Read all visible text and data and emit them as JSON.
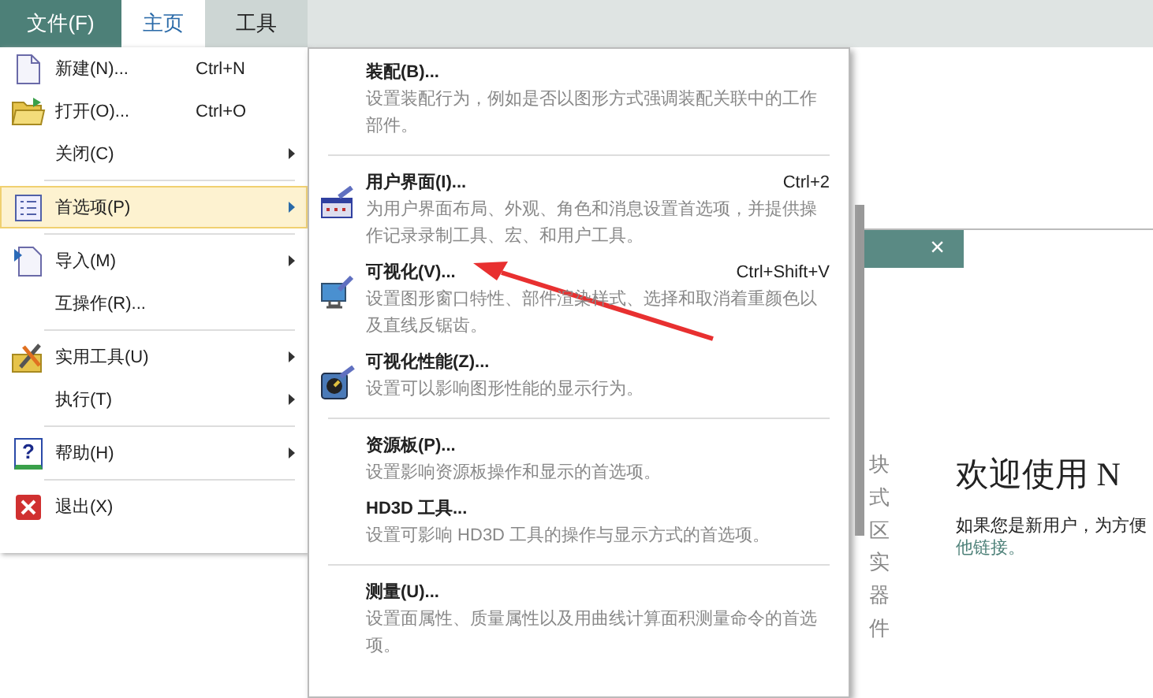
{
  "menu_bar": {
    "tabs": [
      {
        "label": "文件(F)",
        "kind": "file",
        "selected": false
      },
      {
        "label": "主页",
        "kind": "tab",
        "selected": true
      },
      {
        "label": "工具",
        "kind": "tab",
        "selected": false
      }
    ]
  },
  "file_menu": {
    "groups": [
      [
        {
          "label": "新建(N)...",
          "shortcut": "Ctrl+N",
          "submenu": false,
          "selected": false
        },
        {
          "label": "打开(O)...",
          "shortcut": "Ctrl+O",
          "submenu": false,
          "selected": false
        },
        {
          "label": "关闭(C)",
          "submenu": true,
          "selected": false
        }
      ],
      [
        {
          "label": "首选项(P)",
          "submenu": true,
          "selected": true
        }
      ],
      [
        {
          "label": "导入(M)",
          "submenu": true,
          "selected": false
        },
        {
          "label": "互操作(R)...",
          "submenu": false,
          "selected": false
        }
      ],
      [
        {
          "label": "实用工具(U)",
          "submenu": true,
          "selected": false
        },
        {
          "label": "执行(T)",
          "submenu": true,
          "selected": false
        }
      ],
      [
        {
          "label": "帮助(H)",
          "icon_glyph": "?",
          "submenu": true,
          "selected": false
        }
      ],
      [
        {
          "label": "退出(X)",
          "submenu": false,
          "selected": false
        }
      ]
    ]
  },
  "preferences_submenu": {
    "groups": [
      [
        {
          "title": "装配(B)...",
          "description": "设置装配行为，例如是否以图形方式强调装配关联中的工作部件。"
        }
      ],
      [
        {
          "title": "用户界面(I)...",
          "shortcut": "Ctrl+2",
          "description": "为用户界面布局、外观、角色和消息设置首选项，并提供操作记录录制工具、宏、和用户工具。"
        },
        {
          "title": "可视化(V)...",
          "shortcut": "Ctrl+Shift+V",
          "description": "设置图形窗口特性、部件渲染样式、选择和取消着重颜色以及直线反锯齿。"
        },
        {
          "title": "可视化性能(Z)...",
          "description": "设置可以影响图形性能的显示行为。"
        }
      ],
      [
        {
          "title": "资源板(P)...",
          "description": "设置影响资源板操作和显示的首选项。"
        },
        {
          "title": "HD3D 工具...",
          "description": "设置可影响 HD3D 工具的操作与显示方式的首选项。"
        }
      ],
      [
        {
          "title": "测量(U)...",
          "description": "设置面属性、质量属性以及用曲线计算面积测量命令的首选项。"
        }
      ]
    ]
  },
  "background": {
    "close_tab": "×",
    "side_column": "块式区实器件",
    "welcome_title": "欢迎使用 N",
    "welcome_text": "如果您是新用户，为方便",
    "welcome_link": "他链接。"
  }
}
